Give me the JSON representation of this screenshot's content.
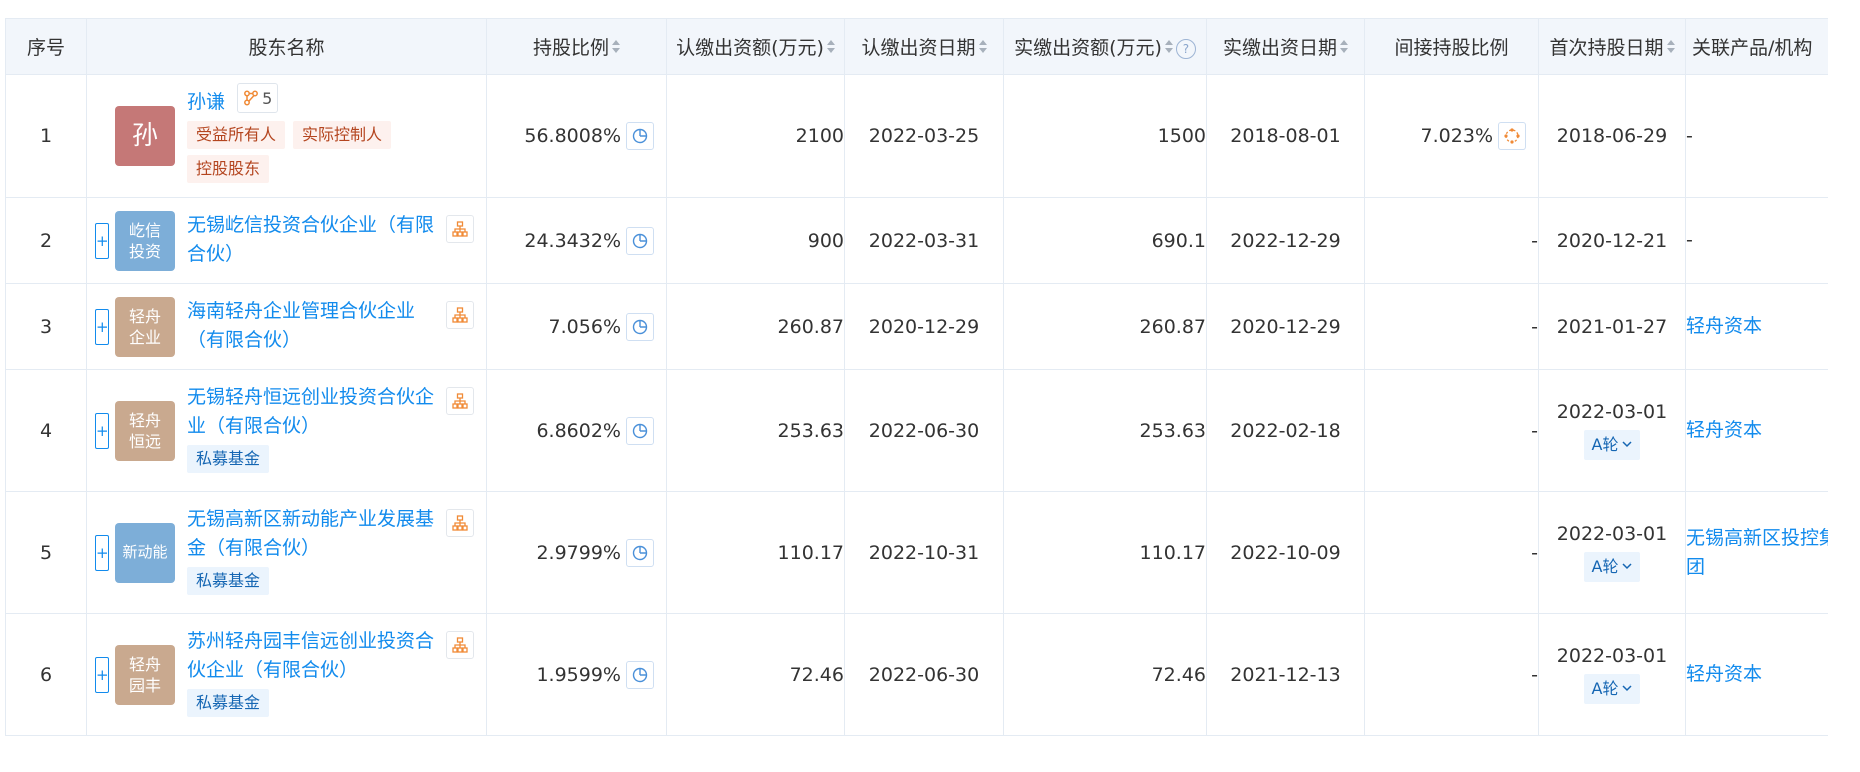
{
  "headers": {
    "idx": "序号",
    "name": "股东名称",
    "ratio": "持股比例",
    "subscribed_amount": "认缴出资额(万元)",
    "subscribed_date": "认缴出资日期",
    "paid_amount": "实缴出资额(万元)",
    "paid_date": "实缴出资日期",
    "indirect_ratio": "间接持股比例",
    "first_date": "首次持股日期",
    "related": "关联产品/机构"
  },
  "colors": {
    "link": "#128bed",
    "header_bg": "#f2f6fb",
    "border": "#e4ebf3"
  },
  "rows": [
    {
      "idx": "1",
      "avatar": "孙",
      "avatar_color": "#c57877",
      "name": "孙谦",
      "badge_count": "5",
      "tags": [
        "受益所有人",
        "实际控制人",
        "控股股东"
      ],
      "ratio": "56.8008%",
      "subscribed_amount": "2100",
      "subscribed_date": "2022-03-25",
      "paid_amount": "1500",
      "paid_date": "2018-08-01",
      "indirect_ratio": "7.023%",
      "first_date": "2018-06-29",
      "round": "",
      "related": "-"
    },
    {
      "idx": "2",
      "avatar": "屹信\n投资",
      "avatar_color": "#7daed8",
      "name": "无锡屹信投资合伙企业（有限合伙）",
      "tags": [],
      "ratio": "24.3432%",
      "subscribed_amount": "900",
      "subscribed_date": "2022-03-31",
      "paid_amount": "690.1",
      "paid_date": "2022-12-29",
      "indirect_ratio": "-",
      "first_date": "2020-12-21",
      "round": "",
      "related": "-"
    },
    {
      "idx": "3",
      "avatar": "轻舟\n企业",
      "avatar_color": "#c9a98f",
      "name": "海南轻舟企业管理合伙企业（有限合伙）",
      "tags": [],
      "ratio": "7.056%",
      "subscribed_amount": "260.87",
      "subscribed_date": "2020-12-29",
      "paid_amount": "260.87",
      "paid_date": "2020-12-29",
      "indirect_ratio": "-",
      "first_date": "2021-01-27",
      "round": "",
      "related": "轻舟资本"
    },
    {
      "idx": "4",
      "avatar": "轻舟\n恒远",
      "avatar_color": "#c9a98f",
      "name": "无锡轻舟恒远创业投资合伙企业（有限合伙）",
      "tags": [
        "私募基金"
      ],
      "ratio": "6.8602%",
      "subscribed_amount": "253.63",
      "subscribed_date": "2022-06-30",
      "paid_amount": "253.63",
      "paid_date": "2022-02-18",
      "indirect_ratio": "-",
      "first_date": "2022-03-01",
      "round": "A轮",
      "related": "轻舟资本"
    },
    {
      "idx": "5",
      "avatar": "新动能",
      "avatar_color": "#7daed8",
      "name": "无锡高新区新动能产业发展基金（有限合伙）",
      "tags": [
        "私募基金"
      ],
      "ratio": "2.9799%",
      "subscribed_amount": "110.17",
      "subscribed_date": "2022-10-31",
      "paid_amount": "110.17",
      "paid_date": "2022-10-09",
      "indirect_ratio": "-",
      "first_date": "2022-03-01",
      "round": "A轮",
      "related": "无锡高新区投控集团"
    },
    {
      "idx": "6",
      "avatar": "轻舟\n园丰",
      "avatar_color": "#c9a98f",
      "name": "苏州轻舟园丰信远创业投资合伙企业（有限合伙）",
      "tags": [
        "私募基金"
      ],
      "ratio": "1.9599%",
      "subscribed_amount": "72.46",
      "subscribed_date": "2022-06-30",
      "paid_amount": "72.46",
      "paid_date": "2021-12-13",
      "indirect_ratio": "-",
      "first_date": "2022-03-01",
      "round": "A轮",
      "related": "轻舟资本"
    }
  ]
}
